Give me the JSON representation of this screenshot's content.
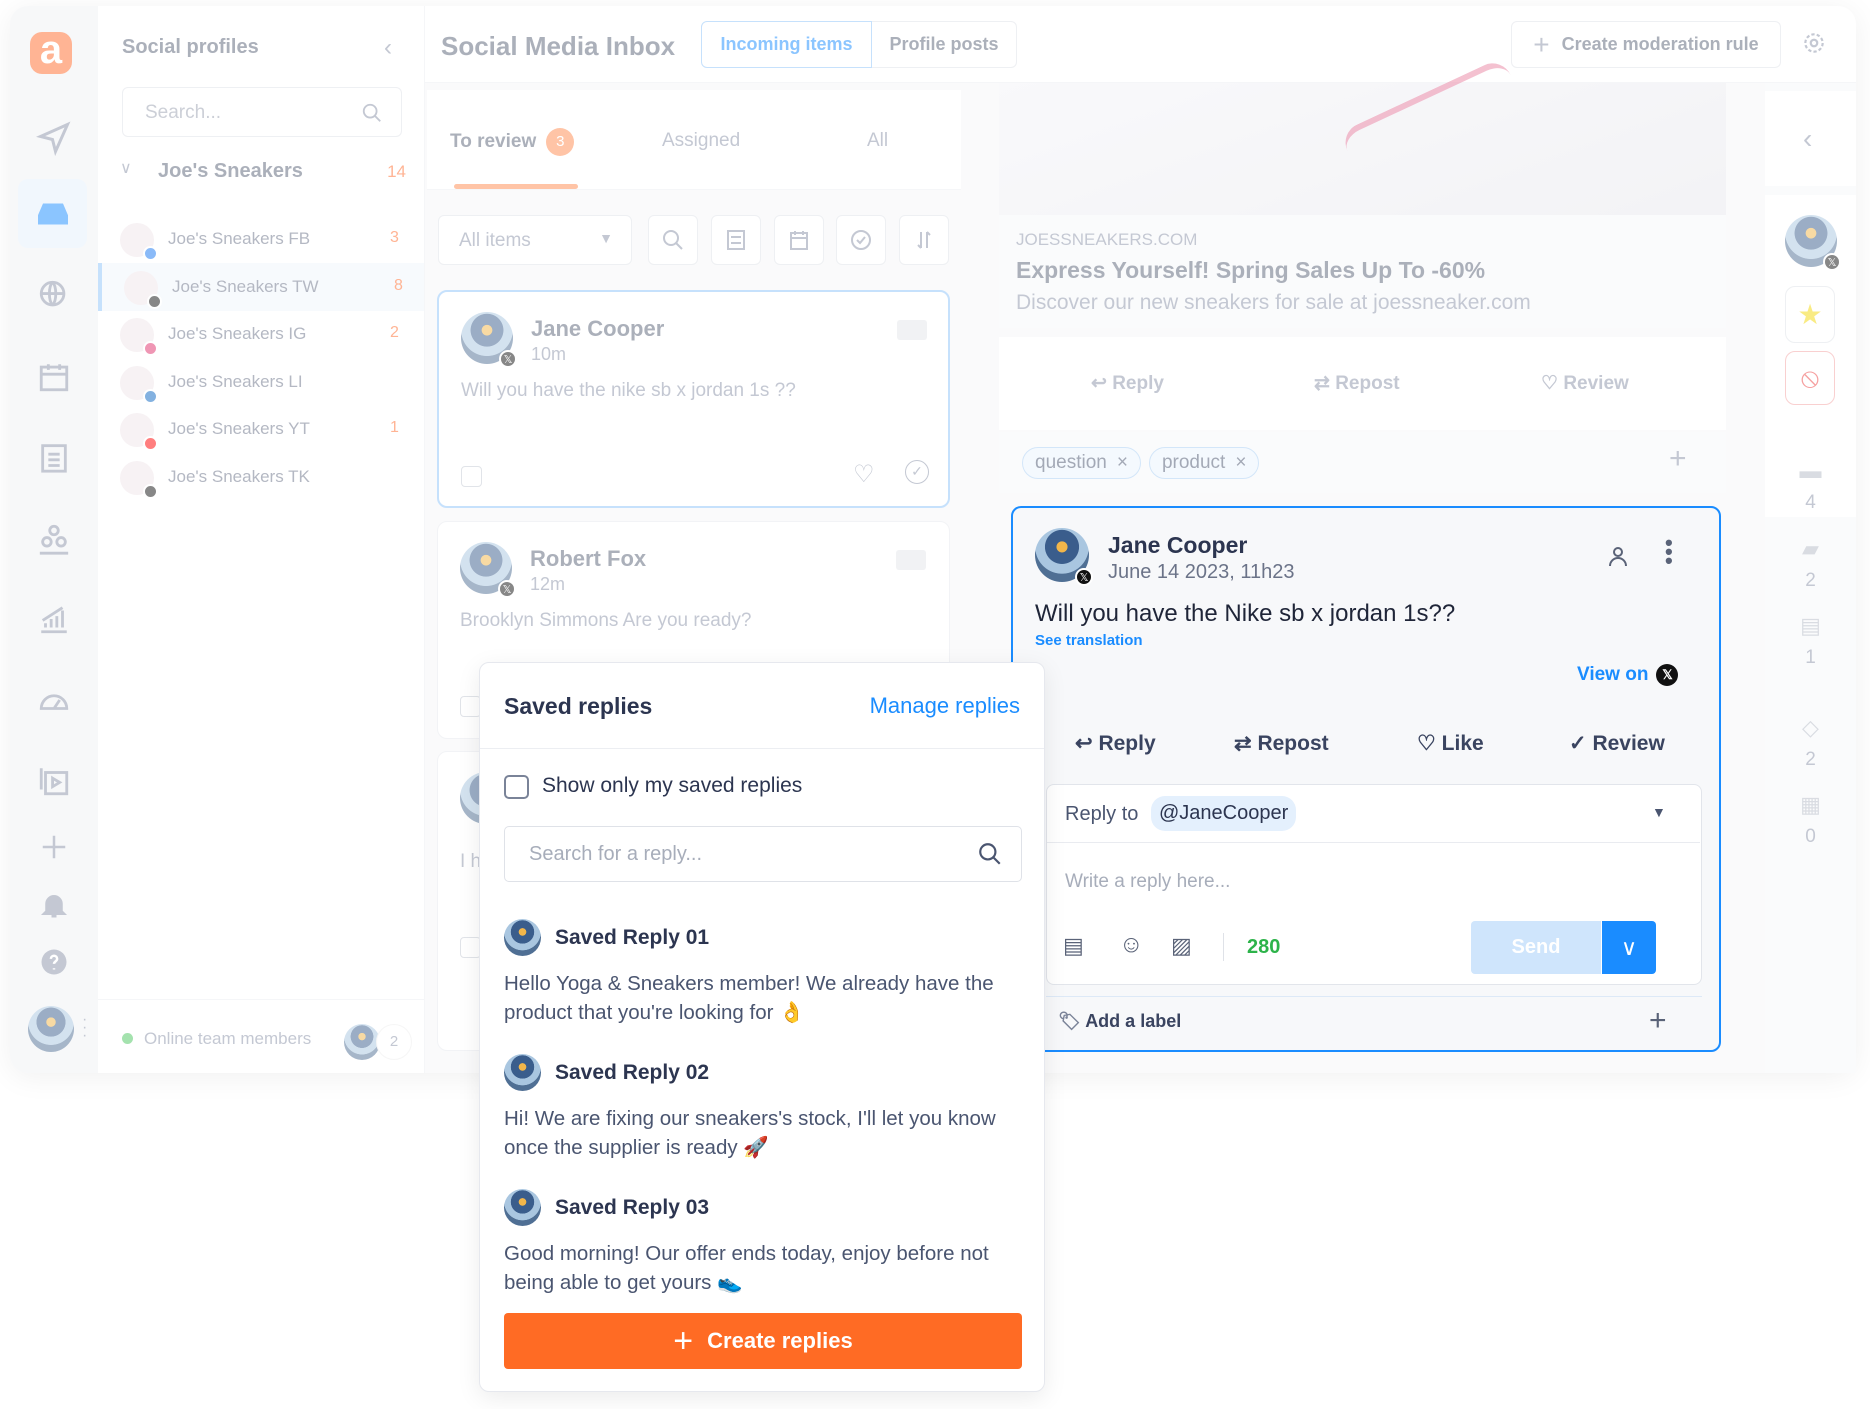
{
  "rail": {
    "icons": [
      "logo",
      "send-icon",
      "inbox-icon",
      "globe-search-icon",
      "calendar-icon",
      "clipboard-icon",
      "team-icon",
      "analytics-icon",
      "dashboard-icon",
      "media-library-icon",
      "plus-icon",
      "bell-icon",
      "help-icon"
    ]
  },
  "profiles": {
    "title": "Social profiles",
    "search_placeholder": "Search...",
    "group": {
      "name": "Joe's Sneakers",
      "count": "14"
    },
    "items": [
      {
        "name": "Joe's Sneakers FB",
        "count": "3",
        "network": "facebook",
        "color": "#1877f2"
      },
      {
        "name": "Joe's Sneakers TW",
        "count": "8",
        "network": "x",
        "color": "#111111"
      },
      {
        "name": "Joe's Sneakers IG",
        "count": "2",
        "network": "instagram",
        "color": "#e1306c"
      },
      {
        "name": "Joe's Sneakers LI",
        "count": "",
        "network": "linkedin",
        "color": "#0a66c2"
      },
      {
        "name": "Joe's Sneakers YT",
        "count": "1",
        "network": "youtube",
        "color": "#ff0000"
      },
      {
        "name": "Joe's Sneakers TK",
        "count": "",
        "network": "tiktok",
        "color": "#111111"
      }
    ],
    "online_label": "Online team members",
    "online_count": "2"
  },
  "header": {
    "title": "Social Media Inbox",
    "tabs": [
      "Incoming items",
      "Profile posts"
    ],
    "moderation_button": "Create moderation rule"
  },
  "inbox": {
    "tabs": [
      {
        "label": "To review",
        "badge": "3"
      },
      {
        "label": "Assigned"
      },
      {
        "label": "All"
      }
    ],
    "filter": "All items",
    "items": [
      {
        "author": "Jane Cooper",
        "time": "10m",
        "message": "Will you have the nike sb x jordan 1s ??"
      },
      {
        "author": "Robert Fox",
        "time": "12m",
        "message": "Brooklyn Simmons Are you ready?"
      },
      {
        "author": "",
        "time": "",
        "message": "I h"
      }
    ]
  },
  "post": {
    "domain": "JOESSNEAKERS.COM",
    "headline": "Express Yourself! Spring Sales Up To -60%",
    "description": "Discover our new sneakers for sale at joessneaker.com",
    "actions": [
      "Reply",
      "Repost",
      "Review"
    ],
    "tags": [
      "question",
      "product"
    ]
  },
  "detail": {
    "author": "Jane Cooper",
    "date": "June 14 2023, 11h23",
    "message": "Will you have the Nike sb x jordan 1s??",
    "see_translation": "See translation",
    "view_on": "View on",
    "actions": [
      "Reply",
      "Repost",
      "Like",
      "Review"
    ],
    "reply_to_label": "Reply to",
    "reply_to_handle": "@JaneCooper",
    "reply_placeholder": "Write a reply here...",
    "char_count": "280",
    "send": "Send",
    "add_label": "Add a label"
  },
  "side": {
    "stats": [
      {
        "icon": "card-icon",
        "value": "4"
      },
      {
        "icon": "comments-icon",
        "value": "2"
      },
      {
        "icon": "note-icon",
        "value": "1"
      },
      {
        "icon": "tag-icon",
        "value": "2"
      },
      {
        "icon": "calendar-note-icon",
        "value": "0"
      }
    ]
  },
  "saved": {
    "title": "Saved replies",
    "manage": "Manage replies",
    "filter_label": "Show only my saved replies",
    "search_placeholder": "Search for a reply...",
    "replies": [
      {
        "title": "Saved Reply 01",
        "body": "Hello Yoga & Sneakers member! We already have the product that you're looking for 👌"
      },
      {
        "title": "Saved Reply 02",
        "body": "Hi! We are fixing our sneakers's stock, I'll let you know once the supplier is ready 🚀"
      },
      {
        "title": "Saved Reply 03",
        "body": "Good morning! Our offer ends today, enjoy before not being able to get yours 👟"
      }
    ],
    "create": "Create replies"
  },
  "colors": {
    "accent": "#1a8cff",
    "brand": "#ff6b2c",
    "count_ok": "#2db34a"
  }
}
